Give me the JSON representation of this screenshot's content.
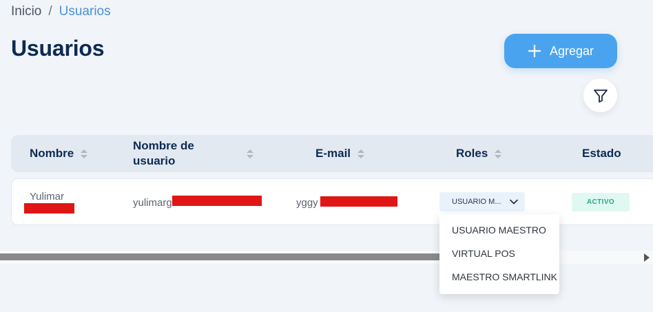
{
  "breadcrumb": {
    "home": "Inicio",
    "separator": "/",
    "current": "Usuarios"
  },
  "page": {
    "title": "Usuarios"
  },
  "actions": {
    "add_label": "Agregar"
  },
  "table": {
    "headers": {
      "name": "Nombre",
      "username": "Nombre de usuario",
      "email": "E-mail",
      "roles": "Roles",
      "status": "Estado"
    },
    "rows": [
      {
        "name": "Yulimar",
        "username": "yulimarg",
        "email": "yggy",
        "role": "USUARIO M...",
        "status": "ACTIVO"
      }
    ]
  },
  "roles_dropdown": {
    "options": [
      "USUARIO MAESTRO",
      "VIRTUAL POS",
      "MAESTRO SMARTLINK"
    ]
  },
  "colors": {
    "accent": "#4aa3ee",
    "title": "#0d2a52",
    "status_active": "#23a889",
    "redaction": "#e01515"
  },
  "icons": {
    "add": "plus-icon",
    "filter": "filter-icon",
    "sort": "sort-icon",
    "dropdown": "chevron-down-icon"
  }
}
